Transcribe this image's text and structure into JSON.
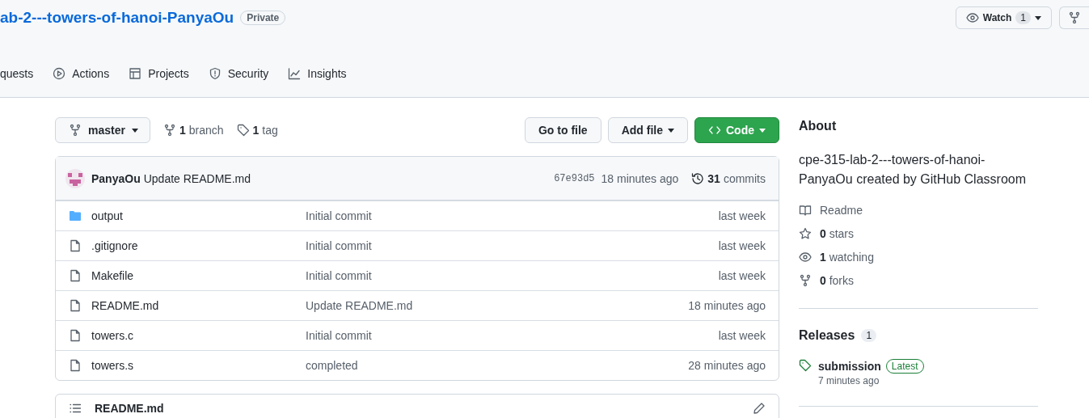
{
  "repo": {
    "title": "ab-2---towers-of-hanoi-PanyaOu",
    "visibility": "Private"
  },
  "header_actions": {
    "watch": {
      "label": "Watch",
      "count": "1"
    }
  },
  "nav_tabs": [
    {
      "label": "quests",
      "selected": false
    },
    {
      "label": "Actions",
      "selected": false
    },
    {
      "label": "Projects",
      "selected": false
    },
    {
      "label": "Security",
      "selected": false
    },
    {
      "label": "Insights",
      "selected": false
    }
  ],
  "toolbar": {
    "branch": "master",
    "branches": {
      "count": "1",
      "label": "branch"
    },
    "tags": {
      "count": "1",
      "label": "tag"
    },
    "go_to_file": "Go to file",
    "add_file": "Add file",
    "code": "Code"
  },
  "latest_commit": {
    "author": "PanyaOu",
    "message": "Update README.md",
    "sha": "67e93d5",
    "time": "18 minutes ago",
    "commits": {
      "count": "31",
      "label": "commits"
    }
  },
  "files": [
    {
      "kind": "folder",
      "name": "output",
      "message": "Initial commit",
      "time": "last week"
    },
    {
      "kind": "file",
      "name": ".gitignore",
      "message": "Initial commit",
      "time": "last week"
    },
    {
      "kind": "file",
      "name": "Makefile",
      "message": "Initial commit",
      "time": "last week"
    },
    {
      "kind": "file",
      "name": "README.md",
      "message": "Update README.md",
      "time": "18 minutes ago"
    },
    {
      "kind": "file",
      "name": "towers.c",
      "message": "Initial commit",
      "time": "last week"
    },
    {
      "kind": "file",
      "name": "towers.s",
      "message": "completed",
      "time": "28 minutes ago"
    }
  ],
  "readme": {
    "title": "README.md"
  },
  "about": {
    "heading": "About",
    "description": "cpe-315-lab-2---towers-of-hanoi-PanyaOu created by GitHub Classroom",
    "stats": [
      {
        "label": "Readme"
      },
      {
        "count": "0",
        "label": "stars"
      },
      {
        "count": "1",
        "label": "watching"
      },
      {
        "count": "0",
        "label": "forks"
      }
    ]
  },
  "releases": {
    "heading": "Releases",
    "count": "1",
    "items": [
      {
        "name": "submission",
        "badge": "Latest",
        "time": "7 minutes ago"
      }
    ]
  }
}
